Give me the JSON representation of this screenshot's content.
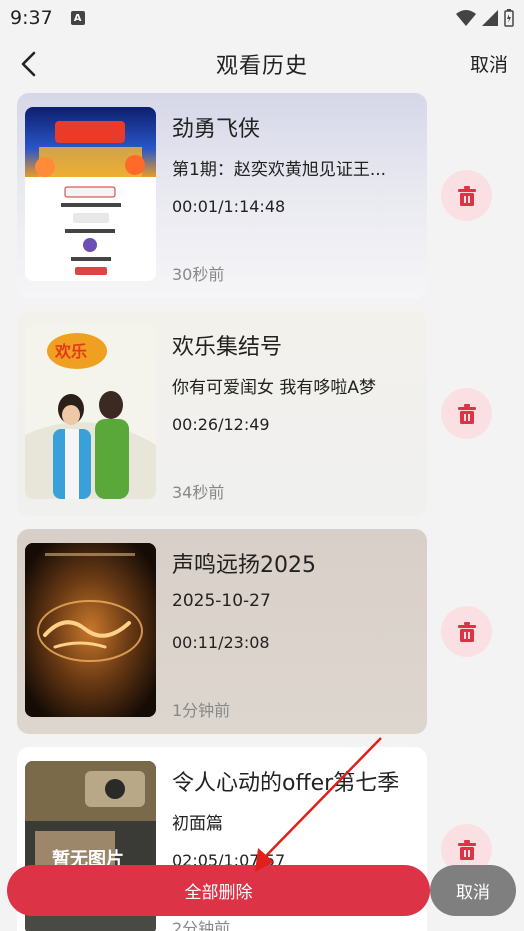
{
  "status_bar": {
    "time": "9:37",
    "notification_letter": "A"
  },
  "header": {
    "title": "观看历史",
    "cancel_label": "取消"
  },
  "items": [
    {
      "title": "劲勇飞侠",
      "subtitle": "第1期：赵奕欢黄旭见证王...",
      "progress": "00:01/1:14:48",
      "time_ago": "30秒前"
    },
    {
      "title": "欢乐集结号",
      "subtitle": "你有可爱闺女 我有哆啦A梦",
      "progress": "00:26/12:49",
      "time_ago": "34秒前"
    },
    {
      "title": "声鸣远扬2025",
      "subtitle": "2025-10-27",
      "progress": "00:11/23:08",
      "time_ago": "1分钟前"
    },
    {
      "title": "令人心动的offer第七季",
      "subtitle": "初面篇",
      "progress": "02:05/1:07:57",
      "time_ago": "2分钟前",
      "thumb_text": "暂无图片"
    }
  ],
  "footer": {
    "delete_all_label": "全部删除",
    "cancel_label": "取消"
  },
  "colors": {
    "accent_red": "#dd3346",
    "delete_bg": "#fbe0e3",
    "cancel_grey": "#7f7f7f"
  }
}
